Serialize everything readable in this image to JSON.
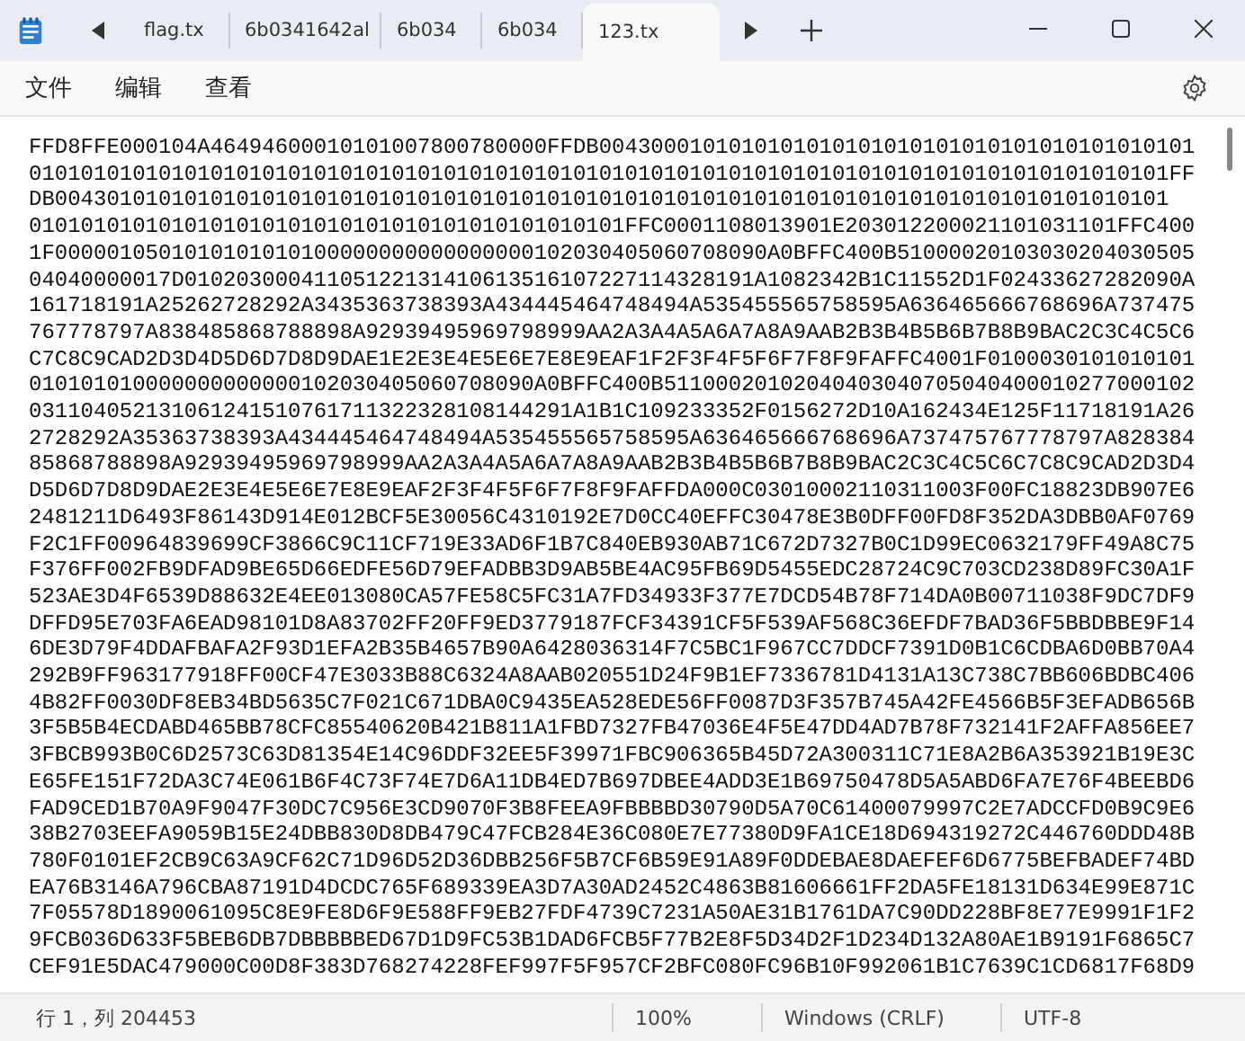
{
  "tabs": [
    {
      "label": "flag.tx",
      "selected": false
    },
    {
      "label": "6b0341642al",
      "selected": false
    },
    {
      "label": "6b034",
      "selected": false
    },
    {
      "label": "6b034",
      "selected": false
    },
    {
      "label": "123.tx",
      "selected": true
    }
  ],
  "menu": [
    "文件",
    "编辑",
    "查看"
  ],
  "lines": [
    "FFD8FFE000104A46494600010101007800780000FFDB0043000101010101010101010101010101010101010101",
    "0101010101010101010101010101010101010101010101010101010101010101010101010101010101010101FF",
    "DB00430101010101010101010101010101010101010101010101010101010101010101010101010101010101",
    "0101010101010101010101010101010101010101010101FFC0001108013901E203012200021101031101FFC400",
    "1F0000010501010101010100000000000000000102030405060708090A0BFFC400B51000020103030204030505",
    "04040000017D01020300041105122131410613516107227114328191A1082342B1C11552D1F02433627282090A",
    "161718191A25262728292A3435363738393A434445464748494A535455565758595A636465666768696A737475",
    "767778797A838485868788898A92939495969798999AA2A3A4A5A6A7A8A9AAB2B3B4B5B6B7B8B9BAC2C3C4C5C6",
    "C7C8C9CAD2D3D4D5D6D7D8D9DAE1E2E3E4E5E6E7E8E9EAF1F2F3F4F5F6F7F8F9FAFFC4001F0100030101010101",
    "010101010000000000000102030405060708090A0BFFC400B51100020102040403040705040400010277000102",
    "031104052131061241510761711322328108144291A1B1C109233352F0156272D10A162434E125F11718191A26",
    "2728292A35363738393A434445464748494A535455565758595A636465666768696A737475767778797A828384",
    "85868788898A92939495969798999AA2A3A4A5A6A7A8A9AAB2B3B4B5B6B7B8B9BAC2C3C4C5C6C7C8C9CAD2D3D4",
    "D5D6D7D8D9DAE2E3E4E5E6E7E8E9EAF2F3F4F5F6F7F8F9FAFFDA000C03010002110311003F00FC18823DB907E6",
    "2481211D6493F86143D914E012BCF5E30056C4310192E7D0CC40EFFC30478E3B0DFF00FD8F352DA3DBB0AF0769",
    "F2C1FF00964839699CF3866C9C11CF719E33AD6F1B7C840EB930AB71C672D7327B0C1D99EC0632179FF49A8C75",
    "F376FF002FB9DFAD9BE65D66EDFE56D79EFADBB3D9AB5BE4AC95FB69D5455EDC28724C9C703CD238D89FC30A1F",
    "523AE3D4F6539D88632E4EE013080CA57FE58C5FC31A7FD34933F377E7DCD54B78F714DA0B00711038F9DC7DF9",
    "DFFD95E703FA6EAD98101D8A83702FF20FF9ED3779187FCF34391CF5F539AF568C36EFDF7BAD36F5BBDBBE9F14",
    "6DE3D79F4DDAFBAFA2F93D1EFA2B35B4657B90A6428036314F7C5BC1F967CC7DDCF7391D0B1C6CDBA6D0BB70A4",
    "292B9FF963177918FF00CF47E3033B88C6324A8AAB020551D24F9B1EF7336781D4131A13C738C7BB606BDBC406",
    "4B82FF0030DF8EB34BD5635C7F021C671DBA0C9435EA528EDE56FF0087D3F357B745A42FE4566B5F3EFADB656B",
    "3F5B5B4ECDABD465BB78CFC85540620B421B811A1FBD7327FB47036E4F5E47DD4AD7B78F732141F2AFFA856EE7",
    "3FBCB993B0C6D2573C63D81354E14C96DDF32EE5F39971FBC906365B45D72A300311C71E8A2B6A353921B19E3C",
    "E65FE151F72DA3C74E061B6F4C73F74E7D6A11DB4ED7B697DBEE4ADD3E1B69750478D5A5ABD6FA7E76F4BEEBD6",
    "FAD9CED1B70A9F9047F30DC7C956E3CD9070F3B8FEEA9FBBBBD30790D5A70C61400079997C2E7ADCCFD0B9C9E6",
    "38B2703EEFA9059B15E24DBB830D8DB479C47FCB284E36C080E7E77380D9FA1CE18D694319272C446760DDD48B",
    "780F0101EF2CB9C63A9CF62C71D96D52D36DBB256F5B7CF6B59E91A89F0DDEBAE8DAEFEF6D6775BEFBADEF74BD",
    "EA76B3146A796CBA87191D4DCDC765F689339EA3D7A30AD2452C4863B81606661FF2DA5FE18131D634E99E871C",
    "7F05578D1890061095C8E9FE8D6F9E588FF9EB27FDF4739C7231A50AE31B1761DA7C90DD228BF8E77E9991F1F2",
    "9FCB036D633F5BEB6DB7DBBBBBED67D1D9FC53B1DAD6FCB5F77B2E8F5D34D2F1D234D132A80AE1B9191F6865C7",
    "CEF91E5DAC479000C00D8F383D768274228FEF997F5F957CF2BFC080FC96B10F992061B1C7639C1CD6817F68D9"
  ],
  "status_bar": {
    "position": "行 1，列 204453",
    "zoom": "100%",
    "line_ending": "Windows (CRLF)",
    "encoding": "UTF-8"
  }
}
